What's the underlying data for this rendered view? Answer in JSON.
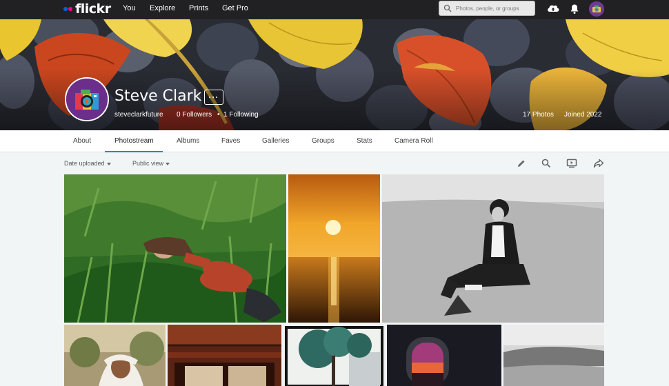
{
  "nav": {
    "logo": "flickr",
    "links": [
      "You",
      "Explore",
      "Prints",
      "Get Pro"
    ],
    "search_placeholder": "Photos, people, or groups",
    "icons": [
      "upload-cloud-icon",
      "bell-icon",
      "user-avatar"
    ]
  },
  "profile": {
    "name": "Steve Clark",
    "username": "steveclarkfuture",
    "followers": "0 Followers",
    "following": "1 Following",
    "photos": "17 Photos",
    "joined": "Joined 2022",
    "more_label": "···"
  },
  "tabs": [
    "About",
    "Photostream",
    "Albums",
    "Faves",
    "Galleries",
    "Groups",
    "Stats",
    "Camera Roll"
  ],
  "active_tab": "Photostream",
  "toolbar": {
    "sort": "Date uploaded",
    "view": "Public view",
    "icons": [
      "edit-icon",
      "search-icon",
      "slideshow-icon",
      "share-icon"
    ]
  },
  "colors": {
    "nav_bg": "#212124",
    "accent": "#008ecf",
    "flickr_blue": "#0063dc",
    "flickr_pink": "#ff0084"
  }
}
